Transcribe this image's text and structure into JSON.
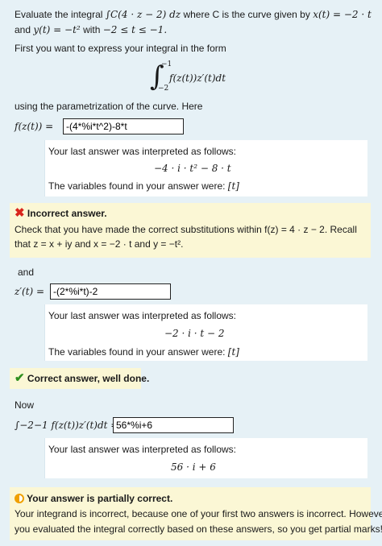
{
  "question": {
    "intro_prefix": "Evaluate the integral",
    "integral_expr": "∫C(4 · z − 2) dz",
    "intro_middle": "where C is the curve given by",
    "x_param": "x(t) = −2 · t",
    "line2_prefix": "and",
    "y_param": "y(t) = −t²",
    "line2_with": "with",
    "t_range": "−2 ≤ t ≤ −1.",
    "express_text": "First you want to express your integral in the form",
    "display_integrand": "f(z(t))z′(t)dt",
    "display_upper": "−1",
    "display_lower": "−2",
    "param_text": "using the parametrization of the curve. Here",
    "f_label": "f(z(t)) =",
    "and_text": "and",
    "zprime_label": "z′(t) =",
    "now_text": "Now",
    "integral_label": "∫−2−1 f(z(t))z′(t)dt ="
  },
  "answers": {
    "f_value": "-(4*%i*t^2)-8*t",
    "zprime_value": "-(2*%i*t)-2",
    "integral_value": "56*%i+6"
  },
  "validation": {
    "interpreted_label": "Your last answer was interpreted as follows:",
    "variables_label": "The variables found in your answer were:",
    "f_interpreted": "−4 · i · t² − 8 · t",
    "f_variables": "[t]",
    "zprime_interpreted": "−2 · i · t − 2",
    "zprime_variables": "[t]",
    "integral_interpreted": "56 · i + 6"
  },
  "feedback": {
    "incorrect_title": "Incorrect answer.",
    "incorrect_line1": "Check that you have made the correct substitutions within f(z) = 4 · z − 2. Recall",
    "incorrect_line2": "that z = x + iy and x = −2 · t and y = −t².",
    "correct_title": "Correct answer, well done.",
    "partial_title": "Your answer is partially correct.",
    "partial_line1": "Your integrand is incorrect, because one of your first two answers is incorrect. However,",
    "partial_line2": "you evaluated the integral correctly based on these answers, so you get partial marks!"
  },
  "icons": {
    "incorrect": "cross-icon",
    "correct": "check-icon",
    "partial": "half-circle-icon"
  },
  "colors": {
    "background": "#e6f1f6",
    "feedback_bg": "#fbf7d5",
    "incorrect": "#d9251c",
    "correct": "#2f8f1f",
    "partial": "#f0a000"
  }
}
